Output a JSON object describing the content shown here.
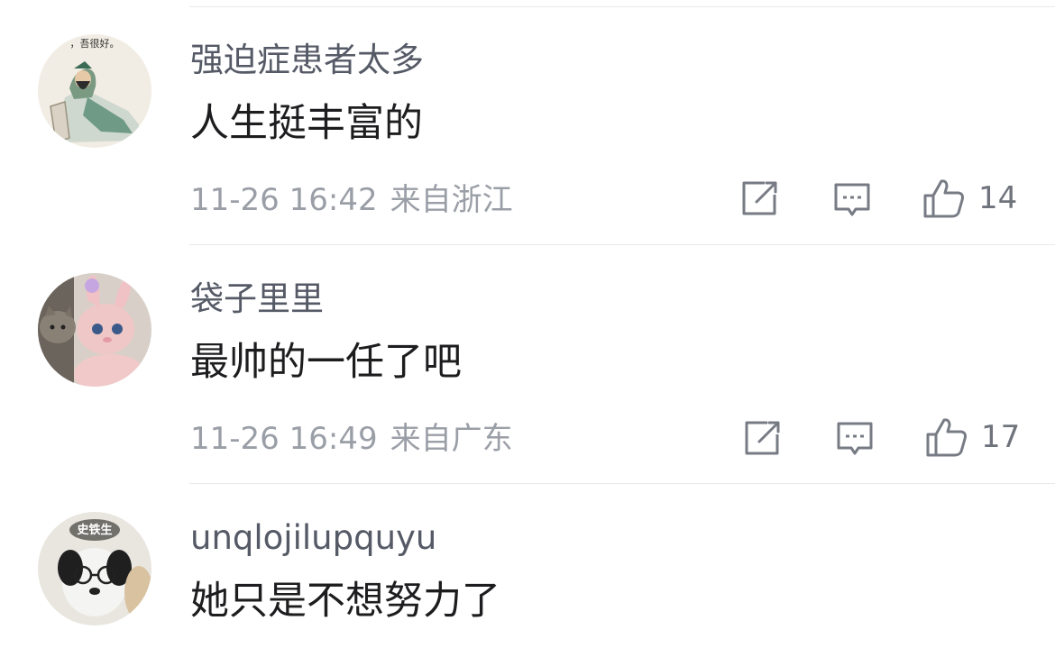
{
  "comments": [
    {
      "username": "强迫症患者太多",
      "content": "人生挺丰富的",
      "time": "11-26 16:42",
      "location": "来自浙江",
      "likes": "14",
      "avatar": "general-figure-avatar",
      "avatar_text": "，吾很好。"
    },
    {
      "username": "袋子里里",
      "content": "最帅的一任了吧",
      "time": "11-26 16:49",
      "location": "来自广东",
      "likes": "17",
      "avatar": "plush-bunny-cat-avatar"
    },
    {
      "username": "unqlojilupquyu",
      "content": "她只是不想努力了",
      "avatar": "dog-glasses-avatar",
      "avatar_text": "史铁生"
    }
  ],
  "icons": {
    "share": "share-icon",
    "reply": "comment-icon",
    "like": "thumbs-up-icon"
  }
}
